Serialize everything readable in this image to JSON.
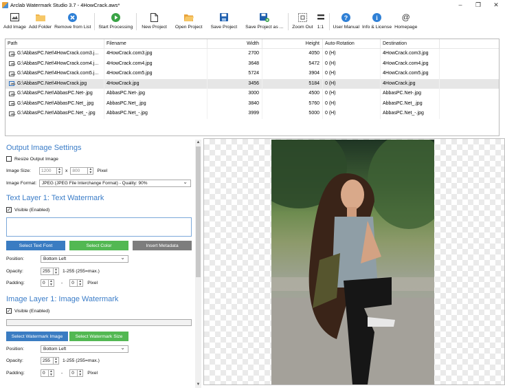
{
  "window": {
    "title": "Arclab Watermark Studio 3.7 - 4HowCrack.aws*",
    "controls": [
      "–",
      "❐",
      "✕"
    ]
  },
  "toolbar": {
    "buttons": [
      {
        "label": "Add Image",
        "icon": "add-image-icon"
      },
      {
        "label": "Add Folder",
        "icon": "folder-icon"
      },
      {
        "label": "Remove from List",
        "icon": "remove-icon"
      },
      {
        "label": "Start Processing",
        "icon": "play-icon"
      },
      {
        "label": "New Project",
        "icon": "new-document-icon"
      },
      {
        "label": "Open Project",
        "icon": "open-folder-icon"
      },
      {
        "label": "Save Project",
        "icon": "save-icon"
      },
      {
        "label": "Save Project as ...",
        "icon": "save-as-icon"
      },
      {
        "label": "Zoom Out",
        "icon": "zoom-out-icon"
      },
      {
        "label": "1:1",
        "icon": "actual-size-icon"
      },
      {
        "label": "User Manual",
        "icon": "help-icon"
      },
      {
        "label": "Info & License",
        "icon": "info-icon"
      },
      {
        "label": "Homepage",
        "icon": "at-icon"
      }
    ]
  },
  "file_table": {
    "columns": [
      "Path",
      "Filename",
      "Width",
      "Height",
      "Auto-Rotation",
      "Destination"
    ],
    "rows": [
      {
        "path": "G:\\AbbasPC.Net\\4HowCrack.com3.j...",
        "filename": "4HowCrack.com3.jpg",
        "width": "2700",
        "height": "4050",
        "rotation": "0 (H)",
        "destination": "4HowCrack.com3.jpg"
      },
      {
        "path": "G:\\AbbasPC.Net\\4HowCrack.com4.j...",
        "filename": "4HowCrack.com4.jpg",
        "width": "3648",
        "height": "5472",
        "rotation": "0 (H)",
        "destination": "4HowCrack.com4.jpg"
      },
      {
        "path": "G:\\AbbasPC.Net\\4HowCrack.com5.j...",
        "filename": "4HowCrack.com5.jpg",
        "width": "5724",
        "height": "3904",
        "rotation": "0 (H)",
        "destination": "4HowCrack.com5.jpg"
      },
      {
        "path": "G:\\AbbasPC.Net\\4HowCrack.jpg",
        "filename": "4HowCrack.jpg",
        "width": "3456",
        "height": "5184",
        "rotation": "0 (H)",
        "destination": "4HowCrack.jpg",
        "selected": true
      },
      {
        "path": "G:\\AbbasPC.Net\\AbbasPC.Net-.jpg",
        "filename": "AbbasPC.Net-.jpg",
        "width": "3000",
        "height": "4500",
        "rotation": "0 (H)",
        "destination": "AbbasPC.Net-.jpg"
      },
      {
        "path": "G:\\AbbasPC.Net\\AbbasPC.Net_.jpg",
        "filename": "AbbasPC.Net_.jpg",
        "width": "3840",
        "height": "5760",
        "rotation": "0 (H)",
        "destination": "AbbasPC.Net_.jpg"
      },
      {
        "path": "G:\\AbbasPC.Net\\AbbasPC.Net_-.jpg",
        "filename": "AbbasPC.Net_-.jpg",
        "width": "3999",
        "height": "5000",
        "rotation": "0 (H)",
        "destination": "AbbasPC.Net_-.jpg"
      }
    ]
  },
  "output_settings": {
    "title": "Output Image Settings",
    "resize_label": "Resize Output Image",
    "resize_checked": false,
    "image_size_label": "Image Size:",
    "width_value": "1200",
    "x_label": "x",
    "height_value": "800",
    "pixel_label": "Pixel",
    "format_label": "Image Format:",
    "format_value": "JPEG (JPEG File Interchange Format) - Quality: 90%"
  },
  "text_layer": {
    "title": "Text Layer 1: Text Watermark",
    "visible_label": "Visible (Enabled)",
    "visible_checked": true,
    "text_value": "",
    "buttons": {
      "font": "Select Text Font",
      "color": "Select Color",
      "metadata": "Insert Metadata"
    },
    "position_label": "Position:",
    "position_value": "Bottom Left",
    "opacity_label": "Opacity:",
    "opacity_value": "255",
    "opacity_hint": "1-255 (255=max.)",
    "padding_label": "Padding:",
    "padding_x": "0",
    "padding_dash": "-",
    "padding_y": "0",
    "padding_unit": "Pixel"
  },
  "image_layer": {
    "title": "Image Layer 1: Image Watermark",
    "visible_label": "Visible (Enabled)",
    "visible_checked": true,
    "path_value": "",
    "buttons": {
      "select": "Select Watermark Image",
      "size": "Select Watermark Size"
    },
    "position_label": "Position:",
    "position_value": "Bottom Left",
    "opacity_label": "Opacity:",
    "opacity_value": "255",
    "opacity_hint": "1-255 (255=max.)",
    "padding_label": "Padding:",
    "padding_x": "0",
    "padding_dash": "-",
    "padding_y": "0",
    "padding_unit": "Pixel"
  },
  "colors": {
    "accent": "#3b7dc8",
    "button_blue": "#3a7cc2",
    "button_green": "#52b852",
    "button_gray": "#7d7d7d"
  }
}
